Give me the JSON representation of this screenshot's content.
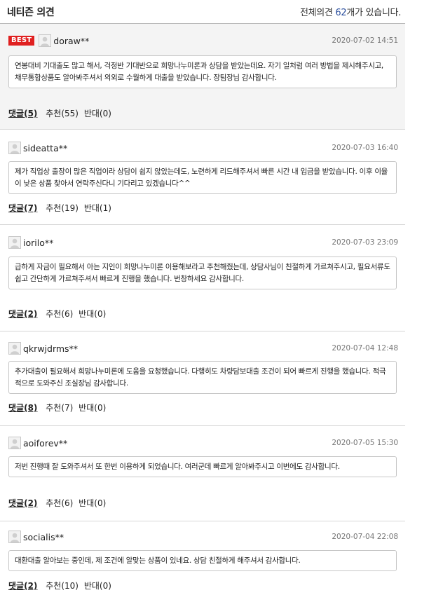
{
  "header": {
    "title": "네티즌 의견",
    "total_prefix": "전체의견 ",
    "total_count": "62",
    "total_suffix": "개가 있습니다."
  },
  "comments": [
    {
      "best_label": "BEST",
      "user": "doraw**",
      "date": "2020-07-02 14:51",
      "text": "연봉대비 기대출도 많고 해서, 걱정반 기대반으로 희망나누미론과 상담을 받았는데요. 자기 일처럼 여러 방법을 제시해주시고, 채무통합상품도 알아봐주셔서 의외로 수월하게 대출을 받았습니다. 장팀장님 감사합니다.",
      "reply_label": "댓글",
      "reply_count": "(5)",
      "up_label": "추천",
      "up_count": "(55)",
      "down_label": "반대",
      "down_count": "(0)"
    },
    {
      "user": "sideatta**",
      "date": "2020-07-03 16:40",
      "text": "제가 직업상 출장이 많은 직업이라 상담이 쉽지 않았는데도, 노련하게 리드해주셔서 빠른 시간 내 입금을 받았습니다. 이후 이율이 낮은 상품 찾아서 연락주신다니 기다리고 있겠습니다^^",
      "reply_label": "댓글",
      "reply_count": "(7)",
      "up_label": "추천",
      "up_count": "(19)",
      "down_label": "반대",
      "down_count": "(1)"
    },
    {
      "user": "iorilo**",
      "date": "2020-07-03 23:09",
      "text": "급하게 자금이 필요해서 아는 지인이 희망나누미론 이용해보라고 추천해줬는데, 상담사님이 친절하게 가르쳐주시고, 필요서류도 쉽고 간단하게 가르쳐주셔서 빠르게 진행을 했습니다. 번창하세요 감사합니다.",
      "reply_label": "댓글",
      "reply_count": "(2)",
      "up_label": "추천",
      "up_count": "(6)",
      "down_label": "반대",
      "down_count": "(0)"
    },
    {
      "user": "qkrwjdrms**",
      "date": "2020-07-04 12:48",
      "text": "추가대출이 필요해서 희망나누미론에 도움을 요청했습니다. 다행히도 차량담보대출 조건이 되어 빠르게 진행을 했습니다. 적극적으로 도와주신 조실장님 감사합니다.",
      "reply_label": "댓글",
      "reply_count": "(8)",
      "up_label": "추천",
      "up_count": "(7)",
      "down_label": "반대",
      "down_count": "(0)"
    },
    {
      "user": "aoiforev**",
      "date": "2020-07-05 15:30",
      "text": "저번 진행때 잘 도와주셔서 또 한번 이용하게 되었습니다. 여러군데 빠르게 알아봐주시고 이번에도 감사합니다.",
      "reply_label": "댓글",
      "reply_count": "(2)",
      "up_label": "추천",
      "up_count": "(6)",
      "down_label": "반대",
      "down_count": "(0)"
    },
    {
      "user": "socialis**",
      "date": "2020-07-04 22:08",
      "text": "대환대출 알아보는 중인데, 제 조건에 알맞는 상품이 있네요. 상담 친절하게 해주셔서 감사합니다.",
      "reply_label": "댓글",
      "reply_count": "(2)",
      "up_label": "추천",
      "up_count": "(10)",
      "down_label": "반대",
      "down_count": "(0)"
    }
  ]
}
